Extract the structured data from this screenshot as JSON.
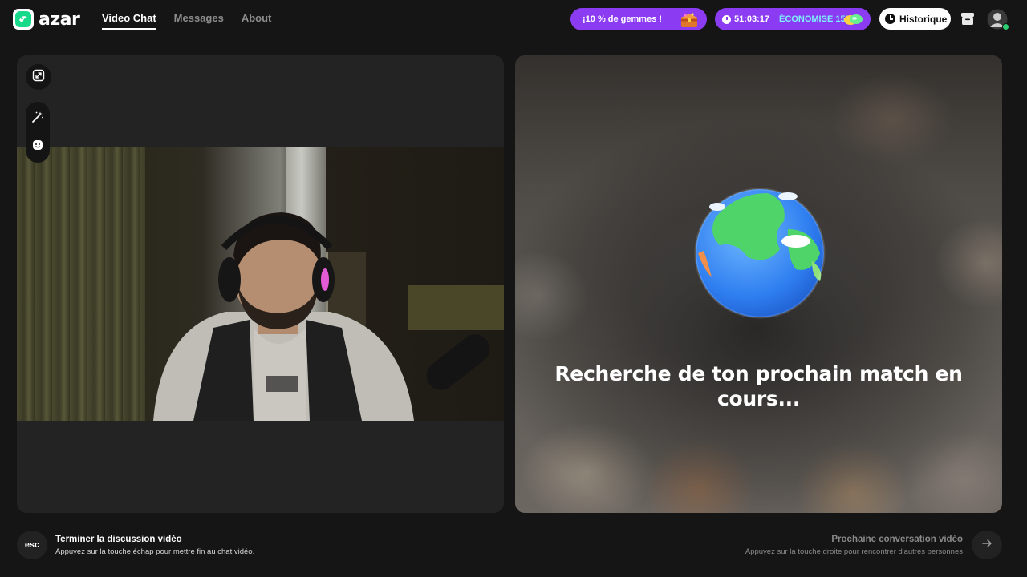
{
  "app": {
    "name": "azar",
    "brand_color": "#16d98a",
    "accent_purple": "#8b3cf2"
  },
  "nav": {
    "items": [
      {
        "label": "Video Chat",
        "active": true
      },
      {
        "label": "Messages",
        "active": false
      },
      {
        "label": "About",
        "active": false
      }
    ]
  },
  "header": {
    "gems_promo": {
      "label": "¡10 % de gemmes !",
      "icon": "treasure-chest-icon"
    },
    "timer_promo": {
      "time": "51:03:17",
      "discount_label": "ÉCONOMISE 15%",
      "icon": "gems-icon"
    },
    "history": {
      "label": "Historique",
      "icon": "clock-icon"
    },
    "store_icon": "store-icon",
    "avatar_icon": "user-avatar-icon"
  },
  "left_panel": {
    "tools": [
      "expand-icon",
      "magic-wand-icon",
      "smiley-icon"
    ]
  },
  "right_panel": {
    "status_text": "Recherche de ton prochain match en cours...",
    "icon": "globe-icon"
  },
  "footer": {
    "end": {
      "key": "esc",
      "title": "Terminer la discussion vidéo",
      "subtitle": "Appuyez sur la touche échap pour mettre fin au chat vidéo."
    },
    "next": {
      "title": "Prochaine conversation vidéo",
      "subtitle": "Appuyez sur la touche droite pour rencontrer d'autres personnes",
      "icon": "arrow-right-icon"
    }
  }
}
